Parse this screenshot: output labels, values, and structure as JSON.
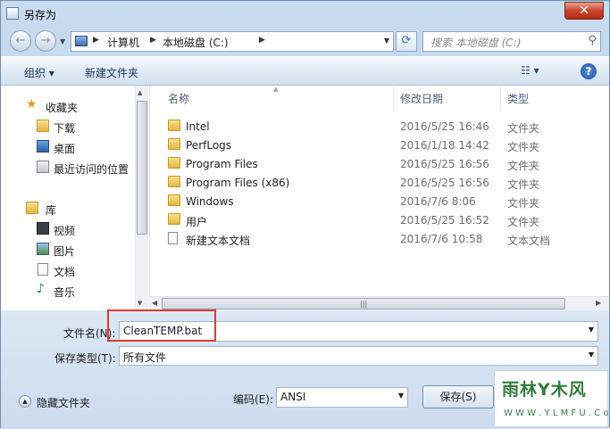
{
  "window": {
    "title": "另存为",
    "close_glyph": "✕"
  },
  "nav": {
    "back_glyph": "←",
    "forward_glyph": "→",
    "breadcrumb": [
      "计算机",
      "本地磁盘 (C:)"
    ],
    "search_placeholder": "搜索 本地磁盘 (C:)"
  },
  "toolbar": {
    "organize": "组织 ▾",
    "new_folder": "新建文件夹",
    "view_icon": "☷ ▾",
    "help": "?"
  },
  "sidebar": {
    "favorites_title": "收藏夹",
    "favorites": [
      "下载",
      "桌面",
      "最近访问的位置"
    ],
    "libraries_title": "库",
    "libraries": [
      "视频",
      "图片",
      "文档",
      "音乐"
    ]
  },
  "columns": {
    "name": "名称",
    "date": "修改日期",
    "type": "类型"
  },
  "files": [
    {
      "name": "Intel",
      "date": "2016/5/25 16:46",
      "type": "文件夹",
      "kind": "folder"
    },
    {
      "name": "PerfLogs",
      "date": "2016/1/18 14:42",
      "type": "文件夹",
      "kind": "folder"
    },
    {
      "name": "Program Files",
      "date": "2016/5/25 16:56",
      "type": "文件夹",
      "kind": "folder"
    },
    {
      "name": "Program Files (x86)",
      "date": "2016/5/25 16:56",
      "type": "文件夹",
      "kind": "folder"
    },
    {
      "name": "Windows",
      "date": "2016/7/6 8:06",
      "type": "文件夹",
      "kind": "folder"
    },
    {
      "name": "用户",
      "date": "2016/5/25 16:52",
      "type": "文件夹",
      "kind": "folder"
    },
    {
      "name": "新建文本文档",
      "date": "2016/7/6 10:58",
      "type": "文本文档",
      "kind": "file"
    }
  ],
  "form": {
    "filename_label": "文件名(N):",
    "filename_value": "CleanTEMP.bat",
    "filetype_label": "保存类型(T):",
    "filetype_value": "所有文件",
    "encoding_label": "编码(E):",
    "encoding_value": "ANSI",
    "hide_folders": "隐藏文件夹",
    "save_button": "保存(S)"
  },
  "watermark": {
    "main": "雨林Y木风",
    "sub": "W W W . Y L M F U . C o M"
  },
  "colors": {
    "highlight": "#e23b2e",
    "folder": "#e2b643"
  }
}
